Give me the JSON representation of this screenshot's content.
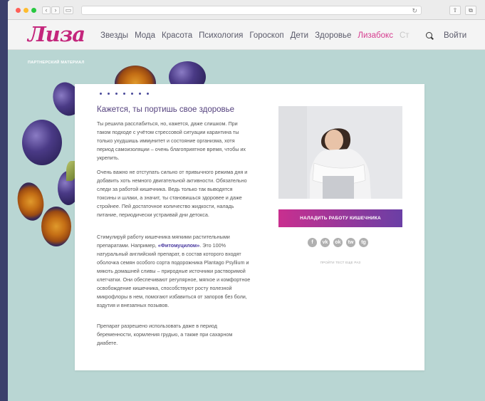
{
  "browser": {
    "back": "‹",
    "forward": "›",
    "reload": "↻"
  },
  "site": {
    "logo": "Лиза",
    "nav": [
      "Звезды",
      "Мода",
      "Красота",
      "Психология",
      "Гороскоп",
      "Дети",
      "Здоровье",
      "Лизабокс",
      "Ст"
    ],
    "login": "Войти",
    "partner": "ПАРТНЕРСКИЙ МАТЕРИАЛ"
  },
  "article": {
    "title": "Кажется, ты портишь свое здоровье",
    "p1": "Ты решила расслабиться, но, кажется, даже слишком. При таком подходе с учётом стрессовой ситуации карантина ты только ухудшишь иммунитет и состояние организма, хотя период самоизоляции – очень благоприятное время, чтобы их укрепить.",
    "p2": "Очень важно не отступать сильно от привычного режима дня и добавить хоть немного двигательной активности. Обязательно следи за работой кишечника. Ведь только так выводятся токсины и шлаки, а значит, ты становишься здоровее и даже стройнее. Пей достаточное количество жидкости, наладь питание, периодически устраивай дни детокса.",
    "p3_before": "Стимулируй работу кишечника мягкими растительными препаратами. Например, ",
    "p3_bold": "«Фитомуцилом»",
    "p3_after": ". Это 100% натуральный английский препарат, в состав которого входят оболочка семян особого сорта подорожника Plantago Psyllium и мякоть домашней сливы – природные источники растворимой клетчатки. Они обеспечивают регулярное, мягкое и комфортное освобождение кишечника, способствуют росту полезной микрофлоры в нем, помогают избавиться от запоров без боли, вздутия и внезапных позывов.",
    "p4": "Препарат разрешено использовать даже в период беременности, кормления грудью, а также при сахарном диабете.",
    "cta": "НАЛАДИТЬ РАБОТУ КИШЕЧНИКА",
    "socials": [
      "f",
      "vk",
      "ok",
      "tw",
      "tg"
    ],
    "pass_again": "ПРОЙТИ ТЕСТ ЕЩЕ РАЗ"
  },
  "colors": {
    "brand": "#c4267c",
    "background": "#b9d6d3",
    "title": "#55427e"
  }
}
